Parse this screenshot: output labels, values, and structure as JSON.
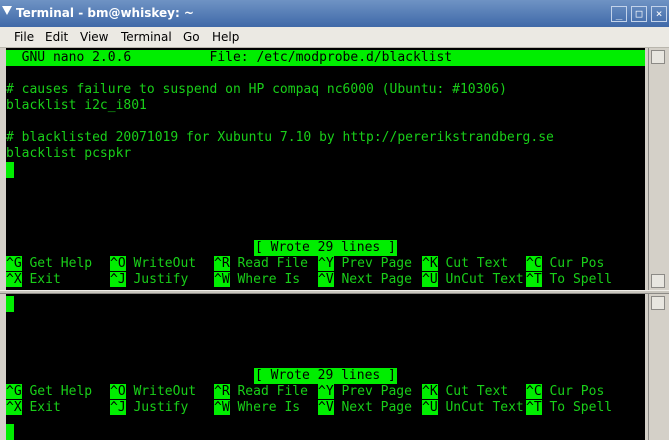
{
  "window": {
    "title": "Terminal - bm@whiskey: ~"
  },
  "menubar": {
    "items": [
      "File",
      "Edit",
      "View",
      "Terminal",
      "Go",
      "Help"
    ]
  },
  "nano": {
    "header": "  GNU nano 2.0.6          File: /etc/modprobe.d/blacklist",
    "lines": [
      "",
      "# causes failure to suspend on HP compaq nc6000 (Ubuntu: #10306)",
      "blacklist i2c_i801",
      "",
      "# blacklisted 20071019 for Xubuntu 7.10 by http://pererikstrandberg.se",
      "blacklist pcspkr"
    ],
    "status": "[ Wrote 29 lines ]",
    "shortcuts_row1": [
      {
        "key": "^G",
        "label": "Get Help"
      },
      {
        "key": "^O",
        "label": "WriteOut"
      },
      {
        "key": "^R",
        "label": "Read File"
      },
      {
        "key": "^Y",
        "label": "Prev Page"
      },
      {
        "key": "^K",
        "label": "Cut Text"
      },
      {
        "key": "^C",
        "label": "Cur Pos"
      }
    ],
    "shortcuts_row2": [
      {
        "key": "^X",
        "label": "Exit"
      },
      {
        "key": "^J",
        "label": "Justify"
      },
      {
        "key": "^W",
        "label": "Where Is"
      },
      {
        "key": "^V",
        "label": "Next Page"
      },
      {
        "key": "^U",
        "label": "UnCut Text"
      },
      {
        "key": "^T",
        "label": "To Spell"
      }
    ]
  },
  "lower_pane": {
    "status": "[ Wrote 29 lines ]"
  },
  "colors": {
    "terminal_bg": "#000000",
    "terminal_fg": "#19cf19",
    "highlight": "#00ee00",
    "titlebar": "#4a74b0"
  }
}
